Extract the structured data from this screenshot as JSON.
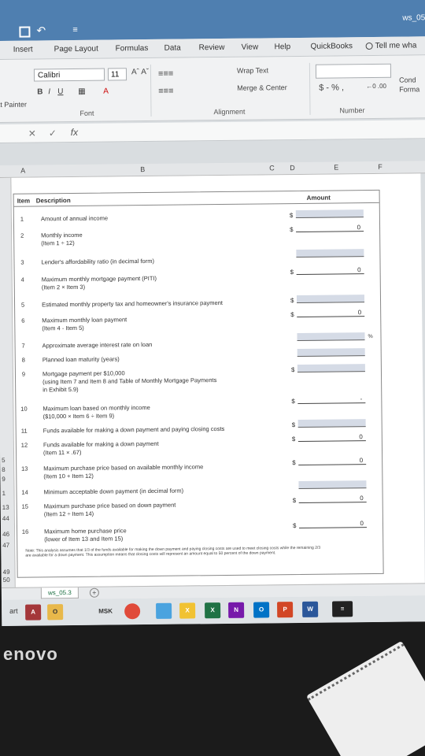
{
  "titlebar": {
    "filename": "ws_05",
    "qat_symbol": "≡"
  },
  "tabs": [
    "Insert",
    "Page Layout",
    "Formulas",
    "Data",
    "Review",
    "View",
    "Help",
    "QuickBooks"
  ],
  "tell_me": "Tell me wha",
  "ribbon": {
    "painter": "at Painter",
    "font_name": "Calibri",
    "font_size": "11",
    "wrap_text": "Wrap Text",
    "merge_center": "Merge & Center",
    "number_symbols": "$ - % ,",
    "cond": "Cond",
    "forma": "Forma",
    "group_font": "Font",
    "group_alignment": "Alignment",
    "group_number": "Number"
  },
  "formula_bar": {
    "fx": "fx"
  },
  "columns": [
    "A",
    "B",
    "C",
    "D",
    "E",
    "F"
  ],
  "rows": [
    "5",
    "8",
    "9",
    "1",
    "13",
    "44",
    "46",
    "47",
    "49",
    "50"
  ],
  "table": {
    "header_item": "Item",
    "header_desc": "Description",
    "header_amount": "Amount",
    "items": [
      {
        "num": "1",
        "desc": "Amount of annual income",
        "sub": "",
        "dollar": "$",
        "value": ""
      },
      {
        "num": "2",
        "desc": "Monthly income",
        "sub": "(Item 1 ÷ 12)",
        "dollar": "$",
        "value": "0"
      },
      {
        "num": "3",
        "desc": "Lender's affordability ratio (in decimal form)",
        "sub": "",
        "dollar": "",
        "value": ""
      },
      {
        "num": "4",
        "desc": "Maximum monthly mortgage payment (PITI)",
        "sub": "(Item 2 × Item 3)",
        "dollar": "$",
        "value": "0"
      },
      {
        "num": "5",
        "desc": "Estimated monthly property tax and homeowner's insurance payment",
        "sub": "",
        "dollar": "$",
        "value": ""
      },
      {
        "num": "6",
        "desc": "Maximum monthly loan payment",
        "sub": "(Item 4 - Item 5)",
        "dollar": "$",
        "value": "0"
      },
      {
        "num": "7",
        "desc": "Approximate average interest rate on loan",
        "sub": "",
        "dollar": "",
        "value": "",
        "suffix": "%"
      },
      {
        "num": "8",
        "desc": "Planned loan maturity (years)",
        "sub": "",
        "dollar": "",
        "value": ""
      },
      {
        "num": "9",
        "desc": "Mortgage payment per $10,000",
        "sub": "(using Item 7 and Item 8 and Table of Monthly Mortgage Payments",
        "sub2": "in Exhibit 5.9)",
        "dollar": "$",
        "value": ""
      },
      {
        "num": "10",
        "desc": "Maximum loan based on monthly income",
        "sub": "($10,000 × Item 6 ÷ Item 9)",
        "dollar": "$",
        "value": "-"
      },
      {
        "num": "11",
        "desc": "Funds available for making a down payment and paying closing costs",
        "sub": "",
        "dollar": "$",
        "value": ""
      },
      {
        "num": "12",
        "desc": "Funds available for making a down payment",
        "sub": "(Item 11 × .67)",
        "dollar": "$",
        "value": "0"
      },
      {
        "num": "13",
        "desc": "Maximum purchase price based on available monthly income",
        "sub": "(Item 10 + Item 12)",
        "dollar": "$",
        "value": "0"
      },
      {
        "num": "14",
        "desc": "Minimum acceptable down payment (in decimal form)",
        "sub": "",
        "dollar": "",
        "value": ""
      },
      {
        "num": "15",
        "desc": "Maximum purchase price based on down payment",
        "sub": "(Item 12 ÷ Item 14)",
        "dollar": "$",
        "value": "0"
      },
      {
        "num": "16",
        "desc": "Maximum home purchase price",
        "sub": "(lower of Item 13 and Item 15)",
        "dollar": "$",
        "value": "0"
      }
    ],
    "note": "Note: This analysis assumes that 1/3 of the funds available for making the down payment and paying closing costs are used to meet closing costs while the remaining 2/3 are available for a down payment. This assumption means that closing costs will represent an amount equal to 50 percent of the down payment."
  },
  "sheet_tab": "ws_05.3",
  "taskbar": {
    "start": "art",
    "icons": [
      "A",
      "O",
      "MSK",
      "",
      "",
      "X",
      "N",
      "O",
      "P",
      "W",
      "≡"
    ]
  },
  "brand": "enovo"
}
